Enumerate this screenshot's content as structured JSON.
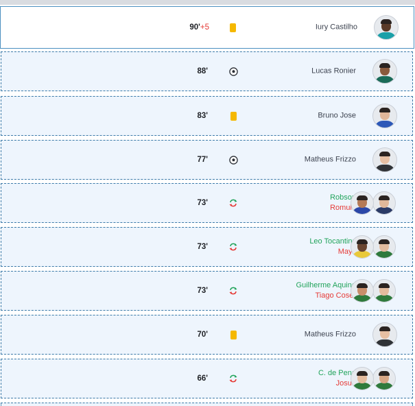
{
  "events": [
    {
      "minute": "90'",
      "added": "+5",
      "type": "yellow-card",
      "players": [
        "Iury Castilho"
      ],
      "kind": "single",
      "shirts": [
        "#1aa0a8"
      ],
      "skins": [
        "#5a3a28"
      ],
      "active": true
    },
    {
      "minute": "88'",
      "added": "",
      "type": "goal",
      "players": [
        "Lucas Ronier"
      ],
      "kind": "single",
      "shirts": [
        "#1a6b58"
      ],
      "skins": [
        "#8a5a3c"
      ],
      "active": false
    },
    {
      "minute": "83'",
      "added": "",
      "type": "yellow-card",
      "players": [
        "Bruno Jose"
      ],
      "kind": "single",
      "shirts": [
        "#2c58b8"
      ],
      "skins": [
        "#e2b79a"
      ],
      "active": false
    },
    {
      "minute": "77'",
      "added": "",
      "type": "goal",
      "players": [
        "Matheus Frizzo"
      ],
      "kind": "single",
      "shirts": [
        "#2f3236"
      ],
      "skins": [
        "#e6bfa3"
      ],
      "active": false
    },
    {
      "minute": "73'",
      "added": "",
      "type": "substitution",
      "player_in": "Robson",
      "player_out": "Romulo",
      "kind": "sub",
      "shirts": [
        "#2b47a8",
        "#2a3a66"
      ],
      "skins": [
        "#b57a56",
        "#e0b89a"
      ],
      "active": false
    },
    {
      "minute": "73'",
      "added": "",
      "type": "substitution",
      "player_in": "Leo Tocantins",
      "player_out": "Mayk",
      "kind": "sub",
      "shirts": [
        "#e9c93a",
        "#2f7a3c"
      ],
      "skins": [
        "#6a4530",
        "#e3bb9d"
      ],
      "active": false
    },
    {
      "minute": "73'",
      "added": "",
      "type": "substitution",
      "player_in": "Guilherme Aquino",
      "player_out": "Tiago Coser",
      "kind": "sub",
      "shirts": [
        "#2f7a3c",
        "#2f7a3c"
      ],
      "skins": [
        "#c98e6a",
        "#e3bb9d"
      ],
      "active": false
    },
    {
      "minute": "70'",
      "added": "",
      "type": "yellow-card",
      "players": [
        "Matheus Frizzo"
      ],
      "kind": "single",
      "shirts": [
        "#2f3236"
      ],
      "skins": [
        "#e6bfa3"
      ],
      "active": false
    },
    {
      "minute": "66'",
      "added": "",
      "type": "substitution",
      "player_in": "C. de Pena",
      "player_out": "Josue",
      "kind": "sub",
      "shirts": [
        "#2f7a3c",
        "#2f7a3c"
      ],
      "skins": [
        "#e3bb9d",
        "#d7a684"
      ],
      "active": false
    }
  ],
  "colors": {
    "sub_in": "#20a35a",
    "sub_out": "#e53935",
    "yellow_card": "#f5b800",
    "row_bg": "#eef5fd",
    "row_border": "#3a79a8"
  },
  "icons": {
    "goal": "soccer-ball-icon",
    "yellow-card": "yellow-card-icon",
    "substitution": "substitution-arrows-icon"
  }
}
